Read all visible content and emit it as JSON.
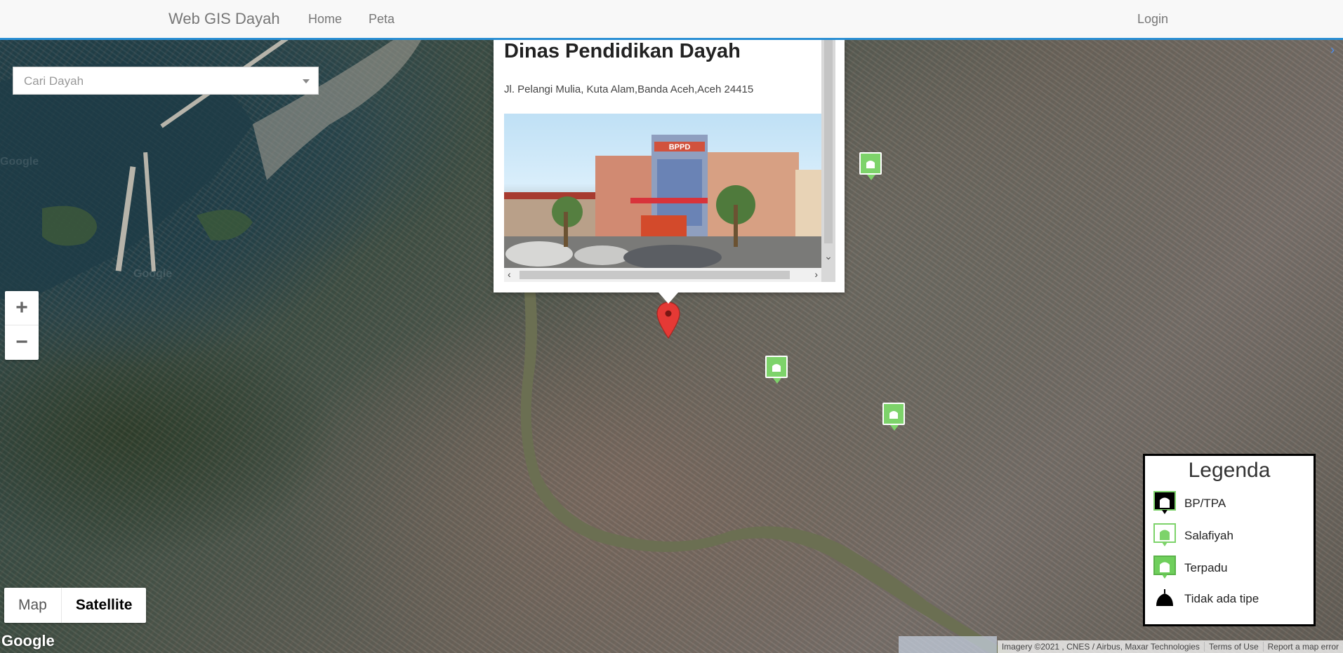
{
  "navbar": {
    "brand": "Web GIS Dayah",
    "links": [
      "Home",
      "Peta"
    ],
    "login": "Login"
  },
  "search": {
    "placeholder": "Cari Dayah"
  },
  "zoom": {
    "in": "+",
    "out": "−"
  },
  "map_type": {
    "map": "Map",
    "satellite": "Satellite",
    "selected": "Satellite"
  },
  "info_window": {
    "title": "Dinas Pendidikan Dayah",
    "address": "Jl. Pelangi Mulia, Kuta Alam,Banda Aceh,Aceh 24415",
    "photo_sign": "BPPD"
  },
  "legend": {
    "title": "Legenda",
    "items": [
      {
        "label": "BP/TPA",
        "icon": "bp-tpa-icon",
        "color": "#000000"
      },
      {
        "label": "Salafiyah",
        "icon": "salafiyah-icon",
        "color": "#a8e89a"
      },
      {
        "label": "Terpadu",
        "icon": "terpadu-icon",
        "color": "#6fcf5c"
      },
      {
        "label": "Tidak ada tipe",
        "icon": "no-type-icon",
        "color": "#000000"
      }
    ]
  },
  "google_logo": "Google",
  "attribution": {
    "imagery": "Imagery ©2021 , CNES / Airbus, Maxar Technologies",
    "terms": "Terms of Use",
    "report": "Report a map error"
  },
  "colors": {
    "accent": "#2a8fd4",
    "marker_green": "#7dd36a",
    "pin_red": "#e53935"
  }
}
